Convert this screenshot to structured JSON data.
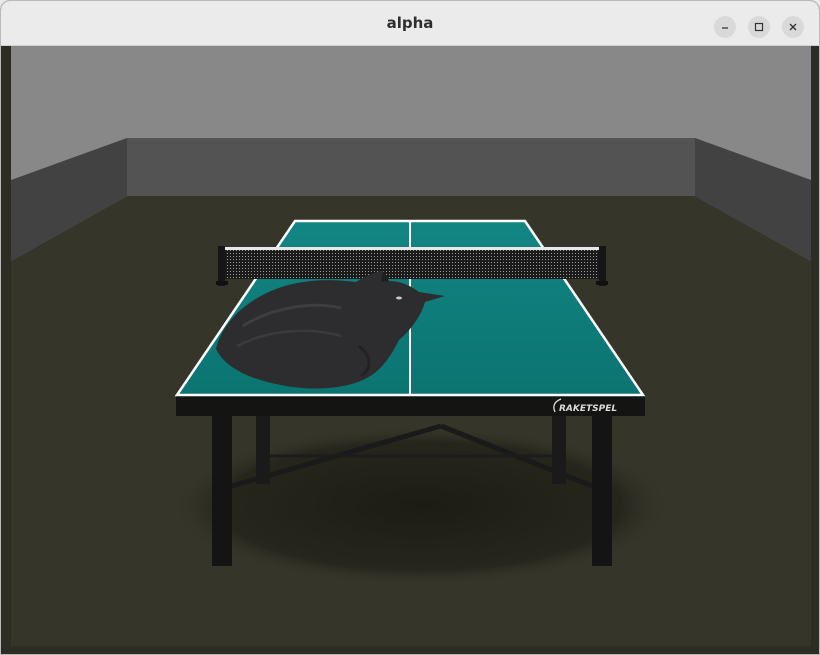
{
  "window": {
    "title": "alpha",
    "controls": {
      "minimize": "minimize-icon",
      "maximize": "maximize-icon",
      "close": "close-icon"
    }
  },
  "scene": {
    "table_brand": "RAKETSPEL",
    "colors": {
      "back_wall": "#888888",
      "back_wall_inner": "#535353",
      "side_wall": "#424242",
      "floor": "#36352a",
      "table_top": "#0e7b78",
      "table_lines": "#ffffff",
      "table_apron": "#141412",
      "cat": "#2d2d2f"
    }
  }
}
